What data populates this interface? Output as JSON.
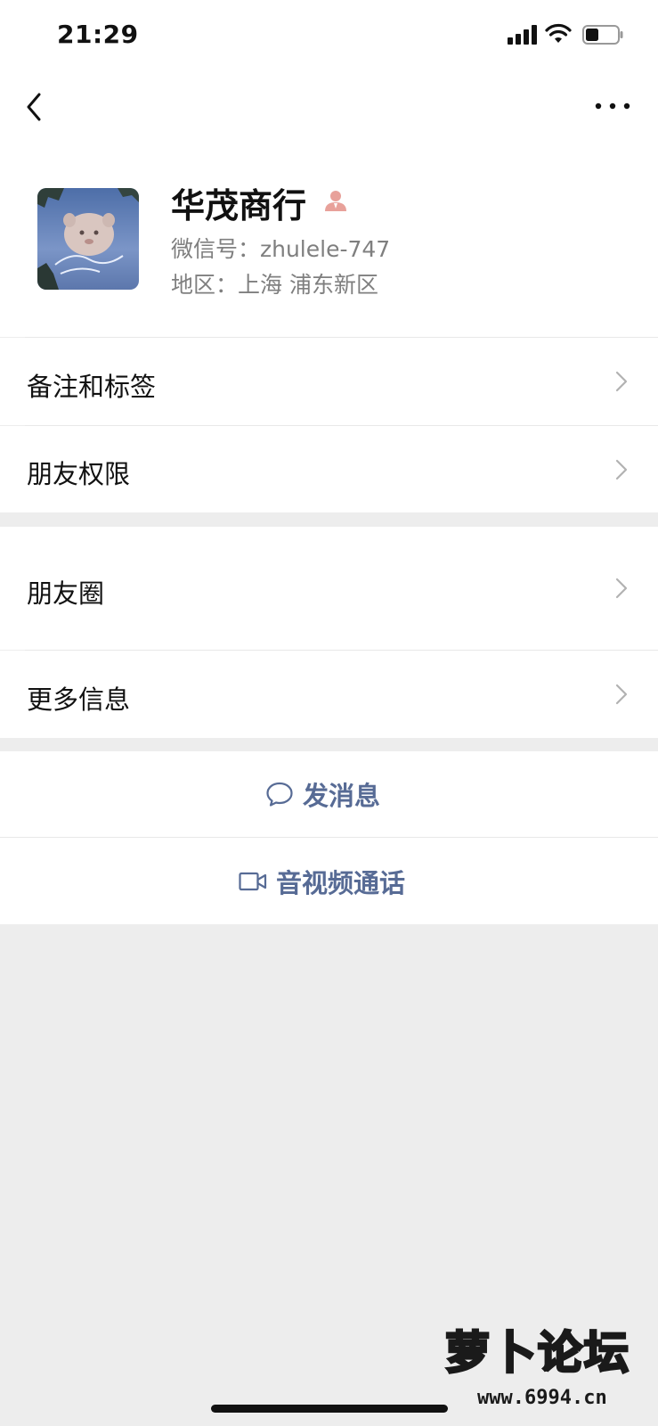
{
  "status_bar": {
    "time": "21:29"
  },
  "profile": {
    "name": "华茂商行",
    "wechat_id": "微信号：zhulele-747",
    "region": "地区：上海 浦东新区"
  },
  "group1": [
    {
      "label": "备注和标签"
    },
    {
      "label": "朋友权限"
    }
  ],
  "group2": [
    {
      "label": "朋友圈"
    },
    {
      "label": "更多信息"
    }
  ],
  "actions": {
    "message": "发消息",
    "call": "音视频通话"
  },
  "watermark": {
    "text": "萝卜论坛",
    "url": "www.6994.cn"
  },
  "colors": {
    "link": "#576b95",
    "background": "#ededed",
    "contact_icon": "#e8a19a"
  }
}
